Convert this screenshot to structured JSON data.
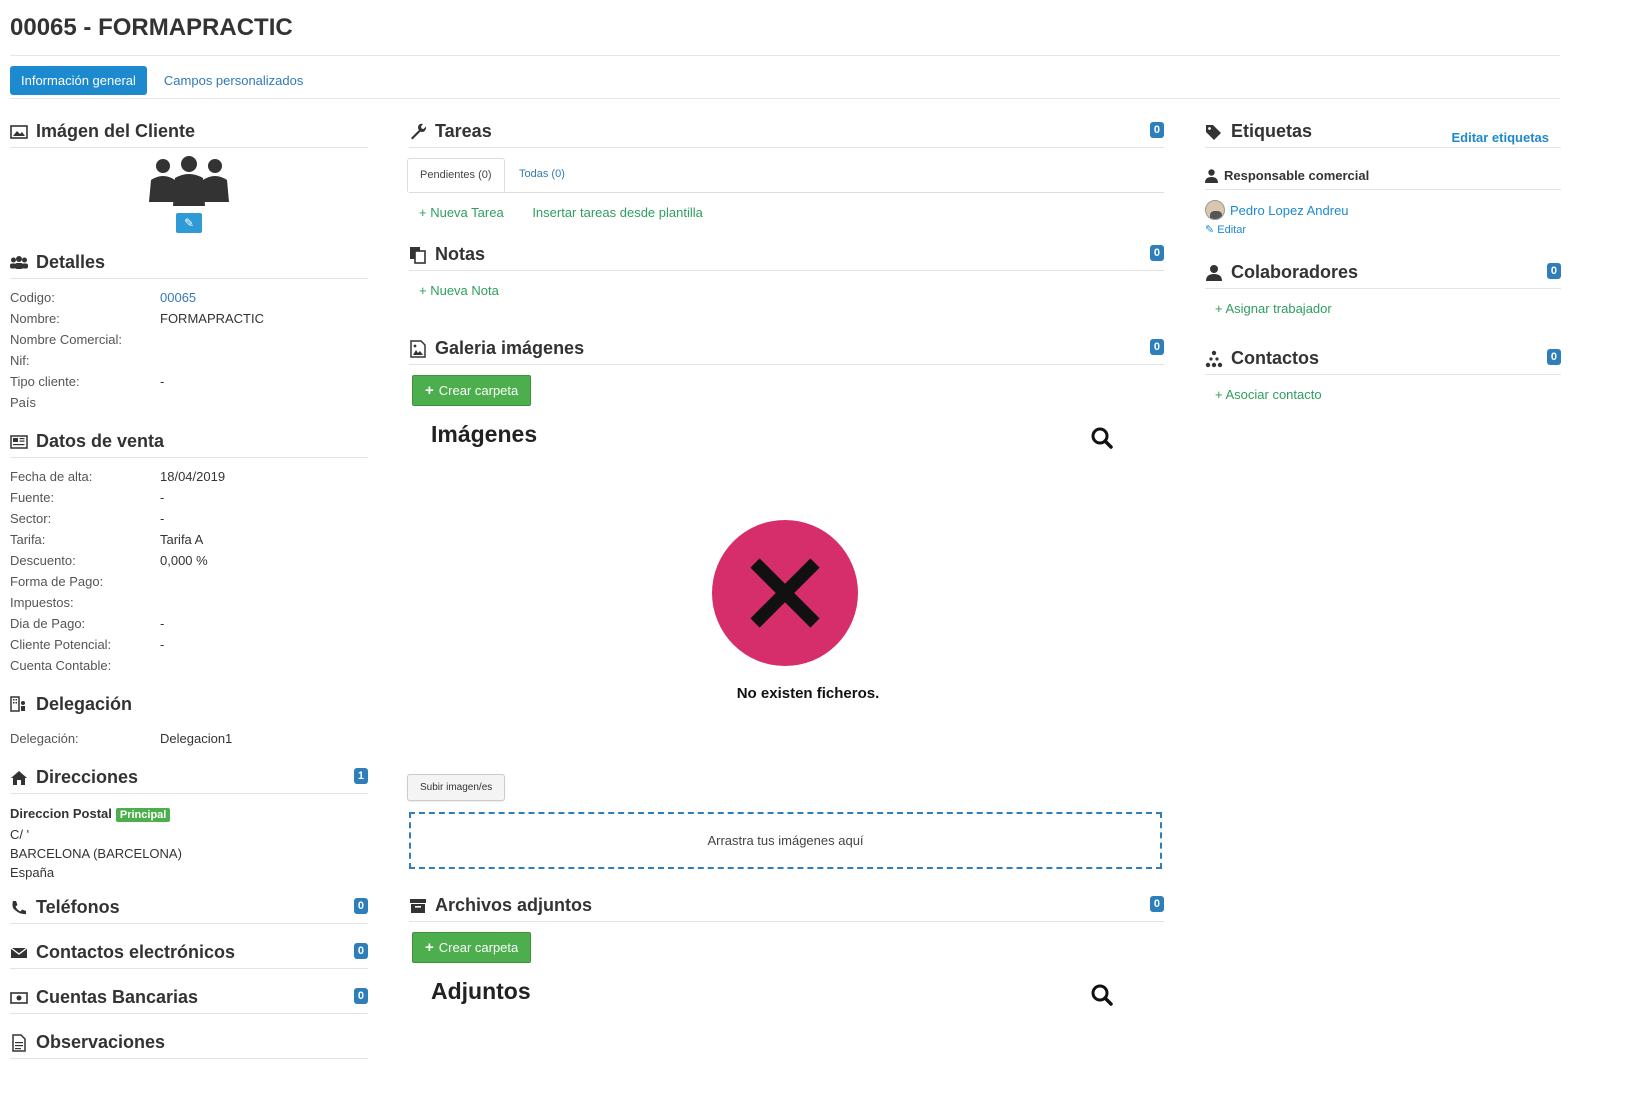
{
  "header": {
    "title": "00065 - FORMAPRACTIC",
    "tabs": [
      "Información general",
      "Campos personalizados"
    ]
  },
  "left": {
    "imagen": {
      "title": "Imágen del Cliente"
    },
    "detalles": {
      "title": "Detalles",
      "rows": [
        {
          "k": "Codigo:",
          "v": "00065"
        },
        {
          "k": "Nombre:",
          "v": "FORMAPRACTIC"
        },
        {
          "k": "Nombre Comercial:",
          "v": ""
        },
        {
          "k": "Nif:",
          "v": ""
        },
        {
          "k": "Tipo cliente:",
          "v": "-"
        },
        {
          "k": "País",
          "v": ""
        }
      ]
    },
    "venta": {
      "title": "Datos de venta",
      "rows": [
        {
          "k": "Fecha de alta:",
          "v": "18/04/2019"
        },
        {
          "k": "Fuente:",
          "v": "-"
        },
        {
          "k": "Sector:",
          "v": "-"
        },
        {
          "k": "Tarifa:",
          "v": "Tarifa A"
        },
        {
          "k": "Descuento:",
          "v": "0,000 %"
        },
        {
          "k": "Forma de Pago:",
          "v": ""
        },
        {
          "k": "Impuestos:",
          "v": ""
        },
        {
          "k": "Dia de Pago:",
          "v": "-"
        },
        {
          "k": "Cliente Potencial:",
          "v": "-"
        },
        {
          "k": "Cuenta Contable:",
          "v": ""
        }
      ]
    },
    "delegacion": {
      "title": "Delegación",
      "k": "Delegación:",
      "v": "Delegacion1"
    },
    "direcciones": {
      "title": "Direcciones",
      "badge": "1",
      "name": "Direccion Postal",
      "label": "Principal",
      "lines": [
        "C/ '",
        "BARCELONA (BARCELONA)",
        "España"
      ]
    },
    "telefonos": {
      "title": "Teléfonos",
      "badge": "0"
    },
    "electronicos": {
      "title": "Contactos electrónicos",
      "badge": "0"
    },
    "bancarias": {
      "title": "Cuentas Bancarias",
      "badge": "0"
    },
    "observaciones": {
      "title": "Observaciones"
    }
  },
  "mid": {
    "tareas": {
      "title": "Tareas",
      "badge": "0",
      "tabs": [
        "Pendientes (0)",
        "Todas (0)"
      ],
      "links": [
        "+ Nueva Tarea",
        "Insertar tareas desde plantilla"
      ]
    },
    "notas": {
      "title": "Notas",
      "badge": "0",
      "link": "+ Nueva Nota"
    },
    "galeria": {
      "title": "Galeria imágenes",
      "badge": "0",
      "btn": "Crear carpeta",
      "heading": "Imágenes",
      "empty": "No existen ficheros.",
      "upload": "Subir imagen/es",
      "drop": "Arrastra tus imágenes aquí"
    },
    "adjuntos": {
      "title": "Archivos adjuntos",
      "badge": "0",
      "btn": "Crear carpeta",
      "heading": "Adjuntos"
    }
  },
  "right": {
    "etiquetas": {
      "title": "Etiquetas",
      "edit": "Editar etiquetas"
    },
    "responsable": {
      "title": "Responsable comercial",
      "name": "Pedro Lopez Andreu",
      "edit": "Editar"
    },
    "colaboradores": {
      "title": "Colaboradores",
      "badge": "0",
      "link": "+ Asignar trabajador"
    },
    "contactos": {
      "title": "Contactos",
      "badge": "0",
      "link": "+ Asociar contacto"
    }
  },
  "colors": {
    "accent": "#1d89cf",
    "badge": "#2f7ebc",
    "green": "#4cae4c",
    "error": "#d62e6a"
  }
}
